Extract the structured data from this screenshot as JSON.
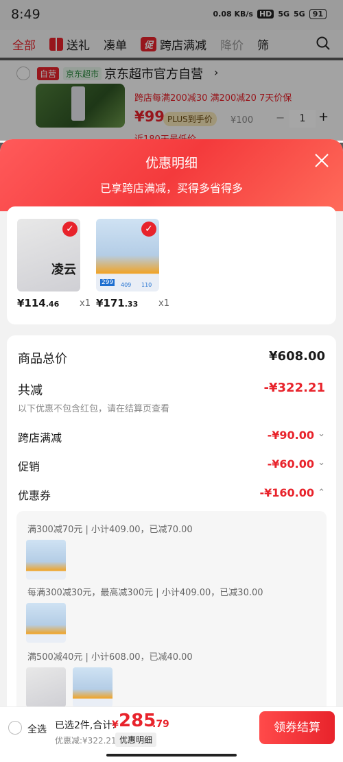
{
  "status": {
    "time": "8:49",
    "net": "0.08 KB/s",
    "hd": "HD",
    "sig1": "5G",
    "sig2": "5G",
    "battery": "91"
  },
  "filters": {
    "all": "全部",
    "gift": "送礼",
    "combine": "凑单",
    "promo_badge": "促",
    "cross_store": "跨店满减",
    "price_drop": "降价",
    "filter": "筛"
  },
  "shop": {
    "self_badge": "自营",
    "jd_badge": "京东超市",
    "name": "京东超市官方自营"
  },
  "product": {
    "promo": "跨店每满200减30  满200减20  7天价保",
    "price": "¥99",
    "plus": "PLUS到手价",
    "orig": "¥100",
    "qty": "1",
    "minus": "−",
    "plus_btn": "+",
    "note": "近180天最低价"
  },
  "sheet": {
    "title": "优惠明细",
    "subtitle": "已享跨店满减，买得多省得多"
  },
  "items": [
    {
      "price_main": "¥114",
      "price_dec": ".46",
      "qty": "x1",
      "brand": "凌云"
    },
    {
      "price_main": "¥171",
      "price_dec": ".33",
      "qty": "x1",
      "tag1": "299",
      "tag2": "409",
      "tag3": "110"
    }
  ],
  "summary": {
    "total_label": "商品总价",
    "total_value": "¥608.00",
    "reduce_label": "共减",
    "reduce_value": "-¥322.21",
    "note": "以下优惠不包含红包，请在结算页查看",
    "rows": [
      {
        "label": "跨店满减",
        "value": "-¥90.00"
      },
      {
        "label": "促销",
        "value": "-¥60.00"
      },
      {
        "label": "优惠券",
        "value": "-¥160.00"
      }
    ]
  },
  "coupons": [
    "满300减70元 | 小计409.00，已减70.00",
    "每满300减30元，最高减300元 | 小计409.00，已减30.00",
    "满500减40元 | 小计608.00，已减40.00"
  ],
  "bottom": {
    "select_all": "全选",
    "selected": "已选2件,合计:",
    "currency": "¥",
    "total_main": "285",
    "total_dec": ".79",
    "discount": "优惠减:¥322.21",
    "detail": "优惠明细",
    "checkout": "领券结算"
  },
  "colors": {
    "accent": "#e8232b"
  }
}
